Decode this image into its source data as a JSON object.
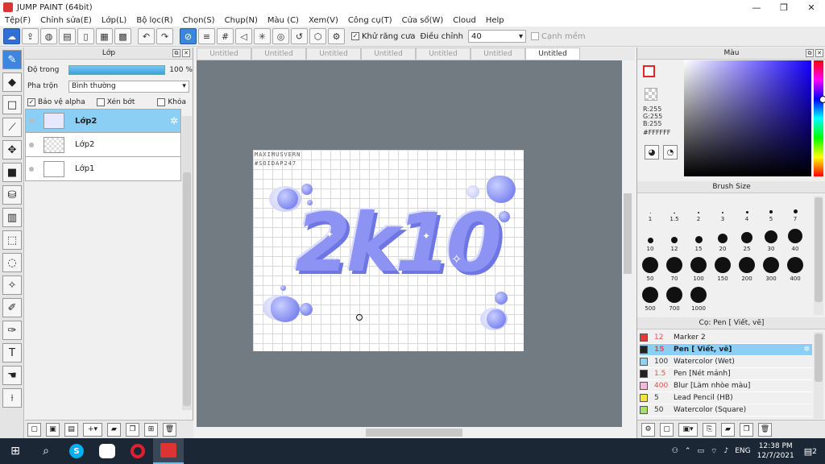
{
  "window": {
    "title": "JUMP PAINT (64bit)",
    "minimize": "—",
    "maximize": "❐",
    "close": "✕"
  },
  "menu": [
    "Tệp(F)",
    "Chỉnh sửa(E)",
    "Lớp(L)",
    "Bộ lọc(R)",
    "Chọn(S)",
    "Chụp(N)",
    "Màu (C)",
    "Xem(V)",
    "Công cụ(T)",
    "Cửa sổ(W)",
    "Cloud",
    "Help"
  ],
  "toolbar": {
    "antialias_label": "Khử răng cưa",
    "antialias_checked": "✓",
    "adjust_label": "Điều chỉnh",
    "adjust_value": "40",
    "smooth_label": "Cạnh mềm"
  },
  "layer_panel": {
    "title": "Lớp",
    "opacity_label": "Độ trong",
    "opacity_value": "100 %",
    "opacity": 1.0,
    "blend_label": "Pha trộn",
    "blend_value": "Bình thường",
    "protect_alpha": "Bảo vệ alpha",
    "clipping": "Xén bớt",
    "lock": "Khóa",
    "layers": [
      {
        "name": "Lớp2",
        "active": true
      },
      {
        "name": "Lớp2",
        "active": false
      },
      {
        "name": "Lớp1",
        "active": false
      }
    ]
  },
  "tabs": [
    "Untitled",
    "Untitled",
    "Untitled",
    "Untitled",
    "Untitled",
    "Untitled",
    "Untitled"
  ],
  "artwork": {
    "line1": "MAXIMUSVERN",
    "line2": "#SOIDAP247",
    "title": "2k10"
  },
  "color_panel": {
    "title": "Màu",
    "r": "R:255",
    "g": "G:255",
    "b": "B:255",
    "hex": "#FFFFFF",
    "accent": "#e22222"
  },
  "brush_panel": {
    "title": "Brush Size",
    "sizes": [
      "1",
      "1.5",
      "2",
      "3",
      "4",
      "5",
      "7",
      "10",
      "12",
      "15",
      "20",
      "25",
      "30",
      "40",
      "50",
      "70",
      "100",
      "150",
      "200",
      "300",
      "400",
      "500",
      "700",
      "1000"
    ]
  },
  "pen_panel": {
    "title": "Cọ: Pen [ Viết, vẽ]",
    "items": [
      {
        "size": "12",
        "name": "Marker 2",
        "color": "#e53935"
      },
      {
        "size": "15",
        "name": "Pen [ Viết, vẽ]",
        "color": "#222222"
      },
      {
        "size": "100",
        "name": "Watercolor (Wet)",
        "color": "#8fd3f5"
      },
      {
        "size": "1.5",
        "name": "Pen [Nét mảnh]",
        "color": "#222222"
      },
      {
        "size": "400",
        "name": "Blur [Làm nhòe màu]",
        "color": "#f5b8d8"
      },
      {
        "size": "5",
        "name": "Lead Pencil (HB)",
        "color": "#f2e533"
      },
      {
        "size": "50",
        "name": "Watercolor (Square)",
        "color": "#a6df6b"
      }
    ]
  },
  "taskbar": {
    "language": "ENG",
    "time": "12:38 PM",
    "date": "12/7/2021",
    "notifications": "2"
  }
}
